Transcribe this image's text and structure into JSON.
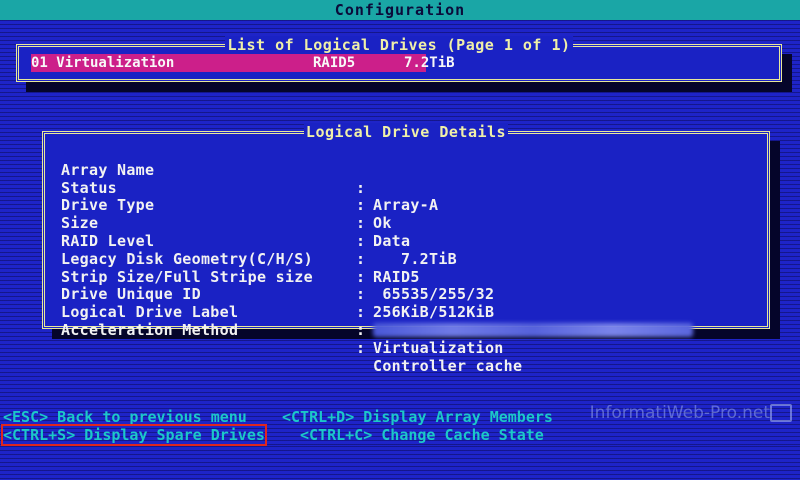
{
  "window": {
    "title": "Configuration"
  },
  "drives_list": {
    "title": "List of Logical Drives (Page 1 of 1)",
    "drives": [
      {
        "name": "01 Virtualization",
        "raid": "RAID5",
        "size": "7.2TiB"
      }
    ]
  },
  "details": {
    "title": "Logical Drive Details",
    "separator": ":",
    "rows": [
      {
        "label": "Array Name",
        "value": "Array-A"
      },
      {
        "label": "Status",
        "value": "Ok"
      },
      {
        "label": "Drive Type",
        "value": "Data"
      },
      {
        "label": "Size",
        "value": "   7.2TiB"
      },
      {
        "label": "RAID Level",
        "value": "RAID5"
      },
      {
        "label": "Legacy Disk Geometry(C/H/S)",
        "value": " 65535/255/32"
      },
      {
        "label": "Strip Size/Full Stripe size",
        "value": "256KiB/512KiB"
      },
      {
        "label": "Drive Unique ID",
        "value": ""
      },
      {
        "label": "Logical Drive Label",
        "value": "Virtualization"
      },
      {
        "label": "Acceleration Method",
        "value": "Controller cache"
      }
    ]
  },
  "footer": {
    "esc_hint": "<ESC> Back to previous menu",
    "ctrl_d_hint": "<CTRL+D> Display Array Members",
    "ctrl_s_hint": "<CTRL+S> Display Spare Drives",
    "ctrl_c_hint": "<CTRL+C> Change Cache State"
  },
  "watermark": {
    "text": "InformatiWeb-Pro.net"
  },
  "colors": {
    "background": "#1e24c8",
    "title_bar": "#1aa6a6",
    "selected_row": "#cc1f8a",
    "border": "#e8e89a",
    "footer_text": "#1cc8c8",
    "highlight_box": "#e0261e"
  }
}
